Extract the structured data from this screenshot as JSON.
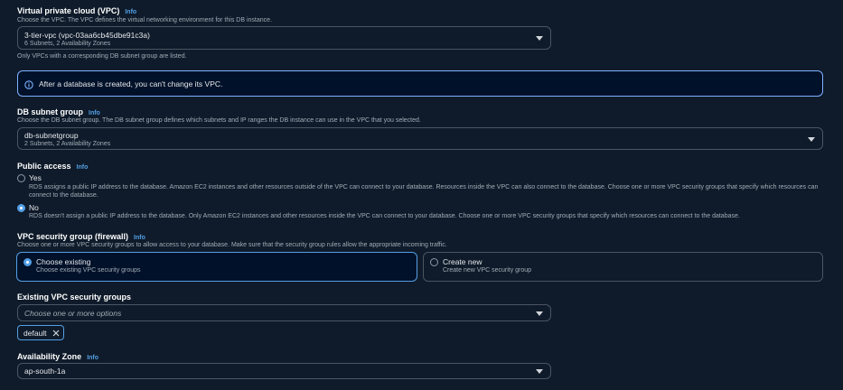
{
  "vpc": {
    "label": "Virtual private cloud (VPC)",
    "info": "Info",
    "description": "Choose the VPC. The VPC defines the virtual networking environment for this DB instance.",
    "selected": "3-tier-vpc (vpc-03aa6cb45dbe91c3a)",
    "selected_detail": "6 Subnets, 2 Availability Zones",
    "hint": "Only VPCs with a corresponding DB subnet group are listed."
  },
  "alert": {
    "text": "After a database is created, you can't change its VPC."
  },
  "subnet_group": {
    "label": "DB subnet group",
    "info": "Info",
    "description": "Choose the DB subnet group. The DB subnet group defines which subnets and IP ranges the DB instance can use in the VPC that you selected.",
    "selected": "db-subnetgroup",
    "selected_detail": "2 Subnets, 2 Availability Zones"
  },
  "public_access": {
    "label": "Public access",
    "info": "Info",
    "options": [
      {
        "label": "Yes",
        "description": "RDS assigns a public IP address to the database. Amazon EC2 instances and other resources outside of the VPC can connect to your database. Resources inside the VPC can also connect to the database. Choose one or more VPC security groups that specify which resources can connect to the database.",
        "selected": false
      },
      {
        "label": "No",
        "description": "RDS doesn't assign a public IP address to the database. Only Amazon EC2 instances and other resources inside the VPC can connect to your database. Choose one or more VPC security groups that specify which resources can connect to the database.",
        "selected": true
      }
    ]
  },
  "security_group": {
    "label": "VPC security group (firewall)",
    "info": "Info",
    "description": "Choose one or more VPC security groups to allow access to your database. Make sure that the security group rules allow the appropriate incoming traffic.",
    "choices": [
      {
        "title": "Choose existing",
        "subtitle": "Choose existing VPC security groups",
        "selected": true
      },
      {
        "title": "Create new",
        "subtitle": "Create new VPC security group",
        "selected": false
      }
    ]
  },
  "existing_groups": {
    "label": "Existing VPC security groups",
    "placeholder": "Choose one or more options",
    "tokens": [
      "default"
    ]
  },
  "availability_zone": {
    "label": "Availability Zone",
    "info": "Info",
    "selected": "ap-south-1a"
  },
  "colors": {
    "background": "#0f1b2a",
    "accent": "#539fe5",
    "alert_border": "#7fb2ff"
  }
}
